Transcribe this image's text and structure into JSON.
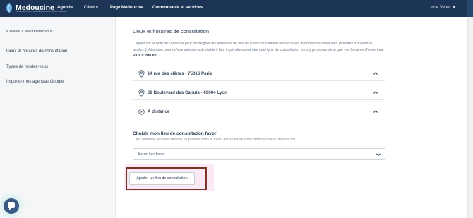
{
  "brand": {
    "name": "Medoucine",
    "tagline": "LE RESEAU DES BIEN-ÊTRE & SANTÉ NATURELLE"
  },
  "nav": {
    "items": [
      "Agenda",
      "Clients",
      "Page Medoucine",
      "Communauté et services"
    ],
    "user": "Lucie Veber"
  },
  "sidebar": {
    "back": "< Retour à Mes rendez-vous",
    "items": [
      "Lieux et horaires de consultation",
      "Types de rendez-vous",
      "Importer mes agendas Google"
    ]
  },
  "main": {
    "title": "Lieux et horaires de consultation",
    "intro": "Cliquez sur le nom de l'adresse pour renseigner les adresses de vos lieux de consultation ainsi que les informations associées (horaires d'ouverture, accès...). Attention pour qu'une adresse soit visible il faut impérativement dire quel type de consultation vous y proposez ainsi que vos horaires d'ouverture.",
    "intro_link": "Plus d'info ici",
    "addresses": [
      "14 rue des clênes - 75016 Paris",
      "69 Boulevard des Canuts - 69004 Lyon",
      "À distance"
    ],
    "favorite": {
      "title": "Choisir mon lieu de consultation favori",
      "help": "C'est l'adresse qui sera affichée en premier dans le menu déroulant de votre profil lors de la prise de rdv.",
      "value": "Aucun lieu favori"
    },
    "add_button": "Ajouter un lieu de consultation"
  },
  "colors": {
    "topbar": "#1c3557",
    "highlight_border": "#7a3526",
    "highlight_fill": "#fbe9f6"
  }
}
